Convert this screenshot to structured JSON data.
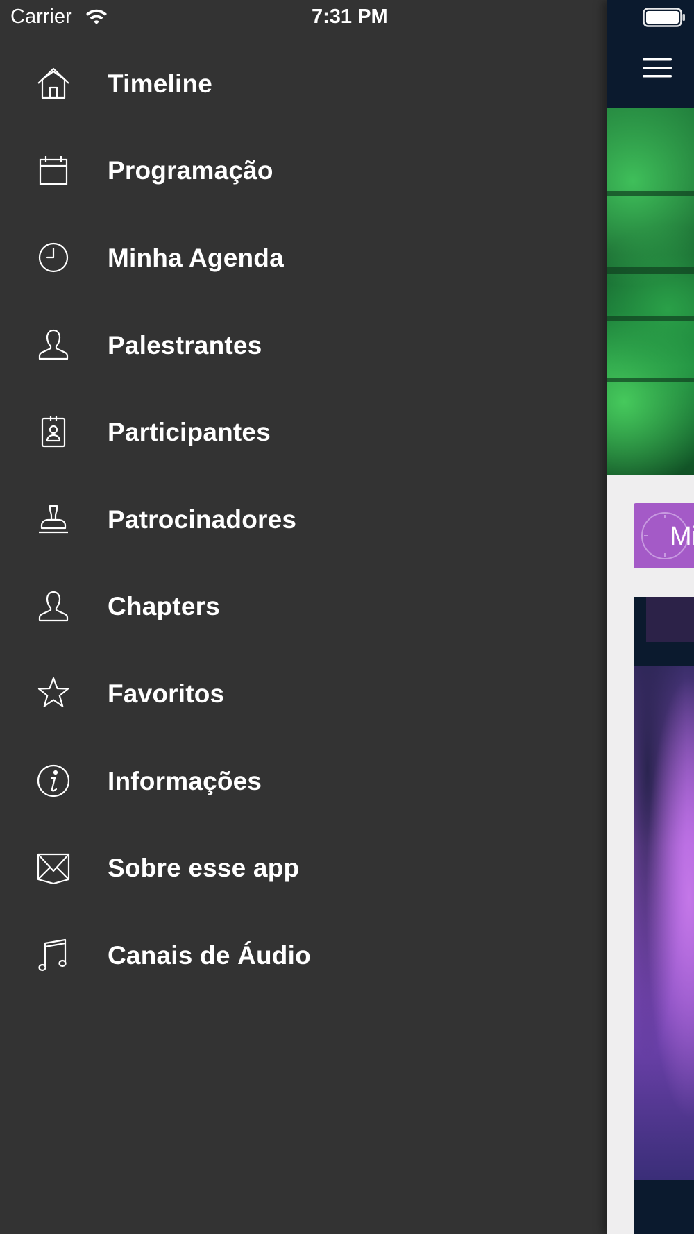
{
  "status_bar": {
    "carrier": "Carrier",
    "time": "7:31 PM"
  },
  "menu": {
    "items": [
      {
        "label": "Timeline",
        "icon": "home-icon"
      },
      {
        "label": "Programação",
        "icon": "calendar-icon"
      },
      {
        "label": "Minha Agenda",
        "icon": "clock-icon"
      },
      {
        "label": "Palestrantes",
        "icon": "person-icon"
      },
      {
        "label": "Participantes",
        "icon": "badge-icon"
      },
      {
        "label": "Patrocinadores",
        "icon": "stamp-icon"
      },
      {
        "label": "Chapters",
        "icon": "person-icon"
      },
      {
        "label": "Favoritos",
        "icon": "star-icon"
      },
      {
        "label": "Informações",
        "icon": "info-icon"
      },
      {
        "label": "Sobre esse app",
        "icon": "envelope-icon"
      },
      {
        "label": "Canais de Áudio",
        "icon": "music-note-icon"
      }
    ]
  },
  "main": {
    "agenda_button_label": "Min"
  },
  "colors": {
    "drawer_bg": "#333333",
    "nav_bar_bg": "#0b1a2e",
    "agenda_accent": "#a45ac7",
    "content_bg": "#efeeef"
  }
}
